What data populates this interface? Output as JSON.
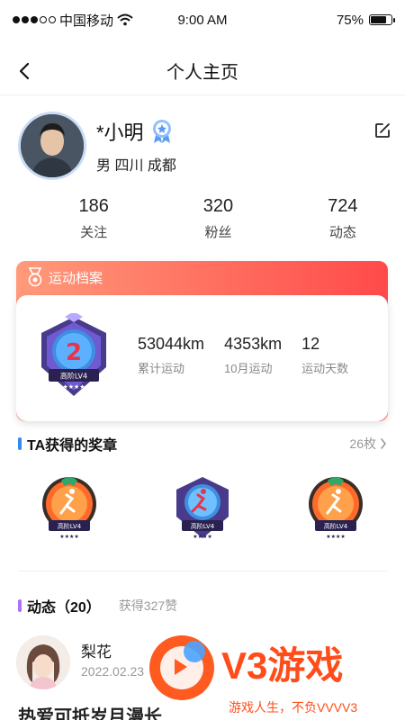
{
  "status_bar": {
    "carrier": "中国移动",
    "time": "9:00 AM",
    "battery": "75%",
    "battery_level": 0.75,
    "signal_full": 3,
    "signal_total": 5
  },
  "nav": {
    "title": "个人主页",
    "back_icon": "chevron-left-icon"
  },
  "profile": {
    "name": "*小明",
    "meta": "男  四川 成都",
    "verified_icon": "medal-badge-icon",
    "edit_icon": "edit-icon",
    "stats": [
      {
        "value": "186",
        "label": "关注"
      },
      {
        "value": "320",
        "label": "粉丝"
      },
      {
        "value": "724",
        "label": "动态"
      }
    ]
  },
  "archive": {
    "title": "运动档案",
    "badge_level": "高阶LV4",
    "badge_number": "2",
    "items": [
      {
        "value": "53044km",
        "label": "累计运动"
      },
      {
        "value": "4353km",
        "label": "10月运动"
      },
      {
        "value": "12",
        "label": "运动天数"
      }
    ]
  },
  "medals": {
    "title": "TA获得的奖章",
    "count": "26枚",
    "items": [
      {
        "label": "高阶LV4"
      },
      {
        "label": "高阶LV4"
      },
      {
        "label": "高阶LV4"
      }
    ]
  },
  "feed": {
    "title": "动态（20）",
    "likes": "获得327赞",
    "post": {
      "author": "梨花",
      "date": "2022.02.23",
      "text": "热爱可抵岁月漫长"
    }
  },
  "watermark": {
    "brand": "V3游戏",
    "slogan": "游戏人生，不负VVVV3"
  },
  "colors": {
    "accent_red": "#ff4a4a",
    "section_blue": "#2d8cf0",
    "section_purple": "#b36cff"
  }
}
